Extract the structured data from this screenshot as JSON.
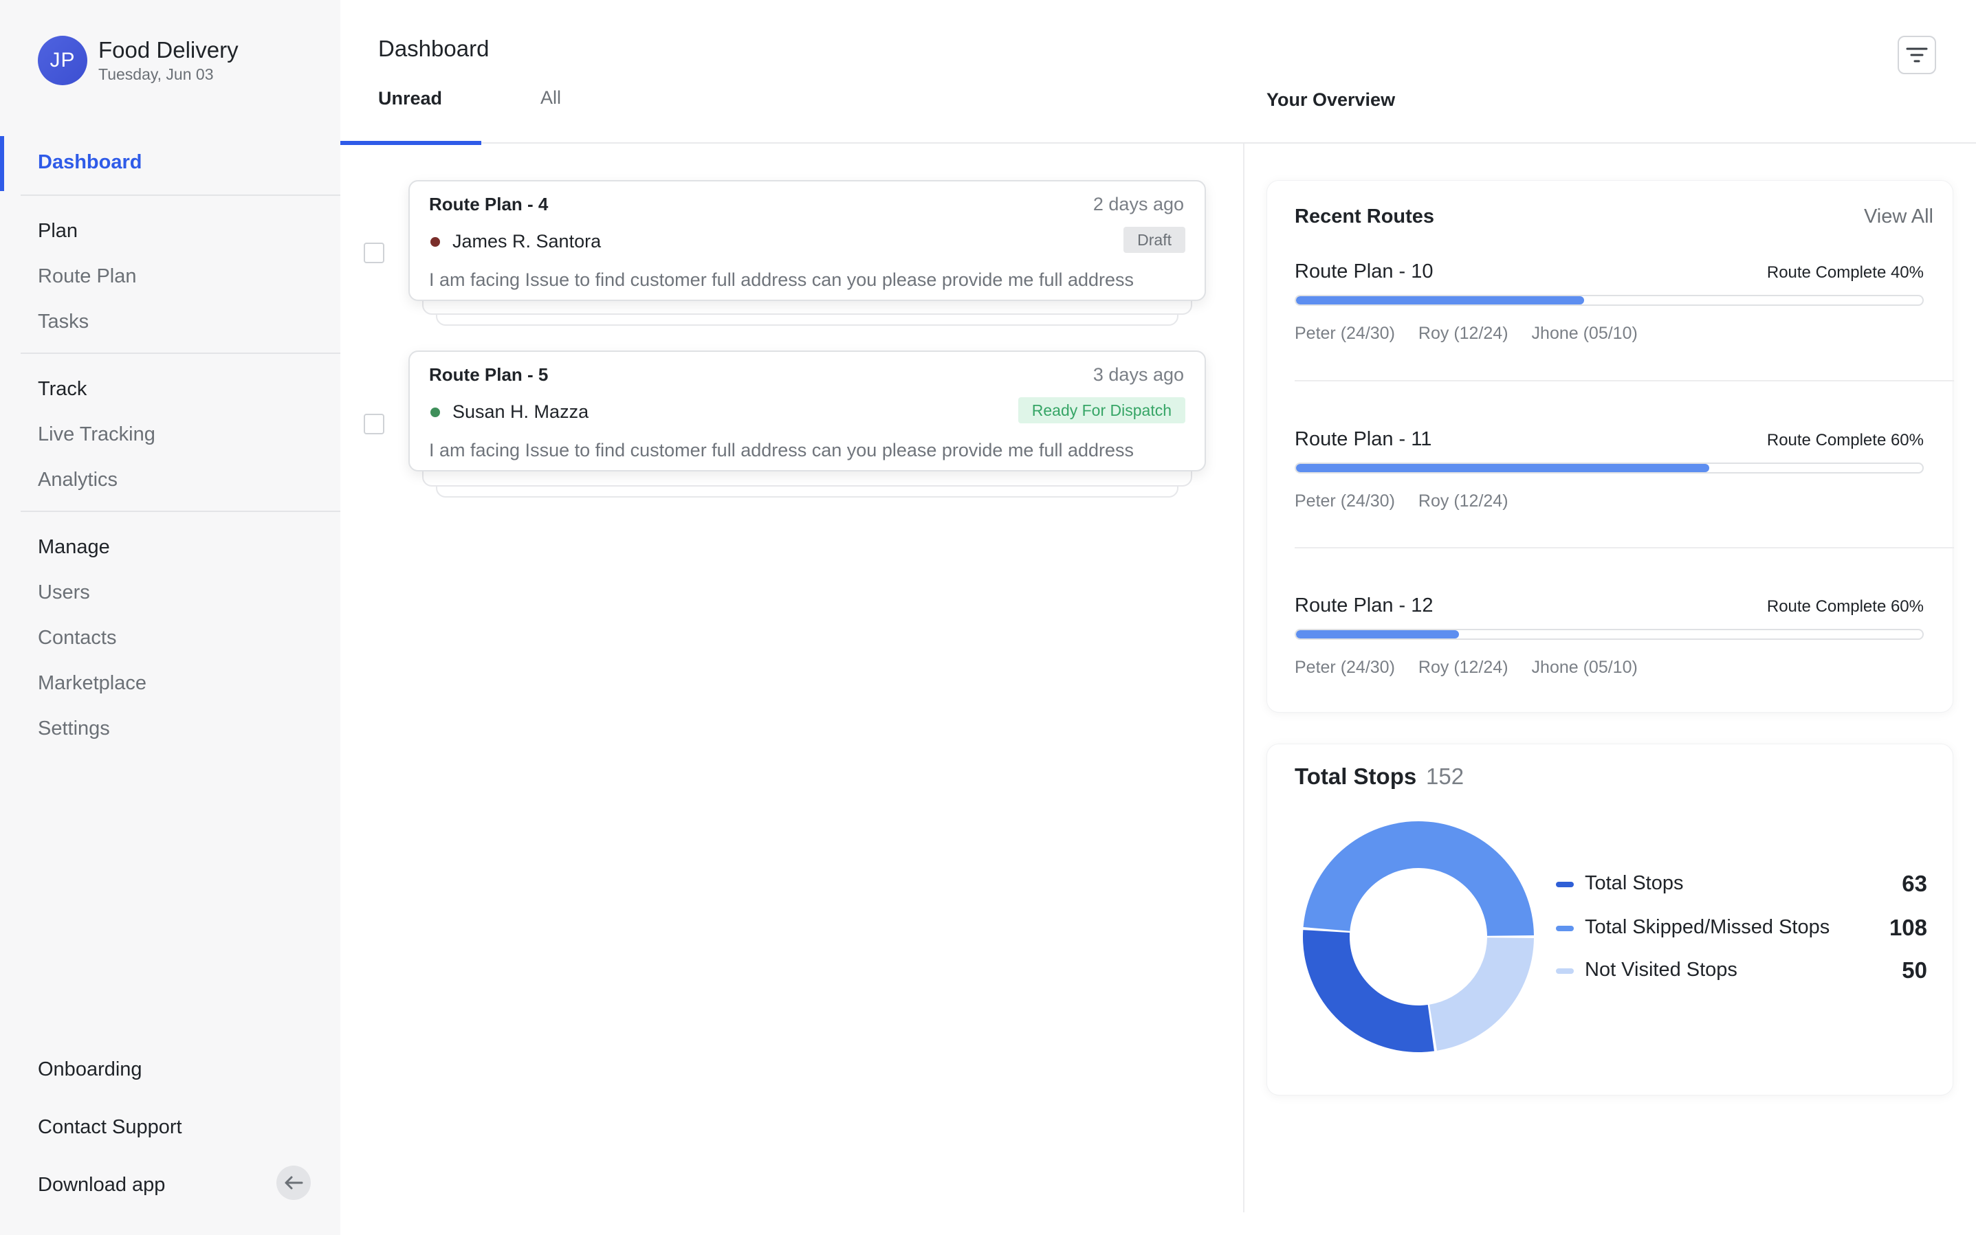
{
  "app": {
    "avatar_initials": "JP",
    "title": "Food Delivery",
    "date": "Tuesday, Jun 03"
  },
  "sidebar": {
    "active": "Dashboard",
    "plan_heading": "Plan",
    "plan_items": [
      "Route Plan",
      "Tasks"
    ],
    "track_heading": "Track",
    "track_items": [
      "Live Tracking",
      "Analytics"
    ],
    "manage_heading": "Manage",
    "manage_items": [
      "Users",
      "Contacts",
      "Marketplace",
      "Settings"
    ],
    "bottom_items": [
      "Onboarding",
      "Contact Support",
      "Download app"
    ]
  },
  "header": {
    "title": "Dashboard",
    "tabs": [
      "Unread",
      "All"
    ],
    "active_tab": "Unread",
    "overview_title": "Your Overview"
  },
  "messages": [
    {
      "title": "Route Plan - 4",
      "time": "2 days ago",
      "person": "James R. Santora",
      "person_dot_color": "#7a2e2a",
      "badge": "Draft",
      "badge_bg": "#e6e7e9",
      "badge_color": "#6b7076",
      "text": "I am facing Issue to find customer full address can you please provide me full address"
    },
    {
      "title": "Route Plan - 5",
      "time": "3 days ago",
      "person": "Susan H. Mazza",
      "person_dot_color": "#3f8f5a",
      "badge": "Ready For Dispatch",
      "badge_bg": "#dff5e8",
      "badge_color": "#36a566",
      "text": "I am facing Issue to find customer full address can you please provide me full address"
    }
  ],
  "recent_routes": {
    "title": "Recent Routes",
    "view_all": "View All",
    "routes": [
      {
        "name": "Route Plan - 10",
        "status": "Route Complete 40%",
        "progress": 0.46,
        "drivers": [
          "Peter (24/30)",
          "Roy (12/24)",
          "Jhone (05/10)"
        ]
      },
      {
        "name": "Route Plan - 11",
        "status": "Route Complete 60%",
        "progress": 0.66,
        "drivers": [
          "Peter (24/30)",
          "Roy (12/24)"
        ]
      },
      {
        "name": "Route Plan - 12",
        "status": "Route Complete 60%",
        "progress": 0.26,
        "drivers": [
          "Peter (24/30)",
          "Roy (12/24)",
          "Jhone (05/10)"
        ]
      }
    ]
  },
  "total_stops": {
    "title": "Total Stops",
    "total": "152",
    "legend": [
      {
        "label": "Total Stops",
        "value": "63",
        "color": "#2f5fd6"
      },
      {
        "label": "Total Skipped/Missed Stops",
        "value": "108",
        "color": "#5e93f0"
      },
      {
        "label": "Not Visited Stops",
        "value": "50",
        "color": "#c2d6f8"
      }
    ]
  },
  "icons": {
    "filter": "filter-icon",
    "collapse": "arrow-left-icon"
  }
}
